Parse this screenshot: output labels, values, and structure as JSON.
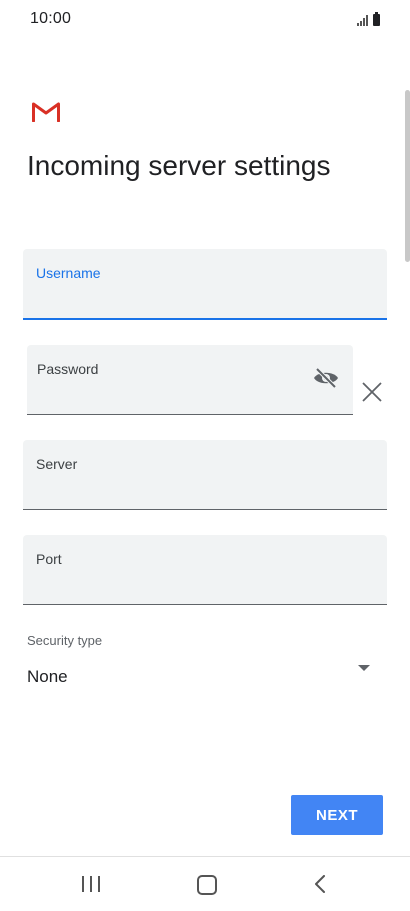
{
  "status_bar": {
    "time": "10:00",
    "signal_icon": "signal-icon",
    "battery_icon": "battery-icon"
  },
  "app": {
    "logo_icon": "gmail-logo-icon",
    "title": "Incoming server settings"
  },
  "form": {
    "username": {
      "label": "Username",
      "value": "",
      "state": "focused"
    },
    "password": {
      "label": "Password",
      "value": "",
      "visibility_icon": "visibility-off-icon",
      "clear_icon": "close-icon"
    },
    "server": {
      "label": "Server",
      "value": ""
    },
    "port": {
      "label": "Port",
      "value": ""
    },
    "security_type": {
      "label": "Security type",
      "value": "None",
      "dropdown_icon": "dropdown-arrow-icon"
    }
  },
  "actions": {
    "next_label": "NEXT"
  },
  "nav_bar": {
    "recents_icon": "recents-icon",
    "home_icon": "home-icon",
    "back_icon": "back-icon"
  },
  "colors": {
    "accent": "#1a73e8",
    "button": "#4285f4",
    "field_bg": "#f1f3f4",
    "gmail_red": "#d93025"
  }
}
